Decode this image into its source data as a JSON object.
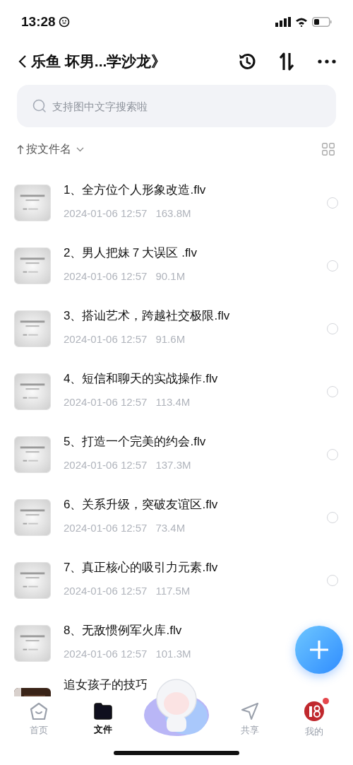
{
  "status_bar": {
    "time": "13:28"
  },
  "header": {
    "title": "乐鱼 坏男...学沙龙》"
  },
  "search": {
    "placeholder": "支持图中文字搜索啦"
  },
  "sort": {
    "label": "按文件名"
  },
  "files": [
    {
      "title": "1、全方位个人形象改造.flv",
      "date": "2024-01-06 12:57",
      "size": "163.8M",
      "selected": false,
      "kind": "light"
    },
    {
      "title": "2、男人把妹７大误区 .flv",
      "date": "2024-01-06 12:57",
      "size": "90.1M",
      "selected": false,
      "kind": "light"
    },
    {
      "title": "3、搭讪艺术，跨越社交极限.flv",
      "date": "2024-01-06 12:57",
      "size": "91.6M",
      "selected": false,
      "kind": "light"
    },
    {
      "title": "4、短信和聊天的实战操作.flv",
      "date": "2024-01-06 12:57",
      "size": "113.4M",
      "selected": false,
      "kind": "light"
    },
    {
      "title": "5、打造一个完美的约会.flv",
      "date": "2024-01-06 12:57",
      "size": "137.3M",
      "selected": false,
      "kind": "light"
    },
    {
      "title": "6、关系升级，突破友谊区.flv",
      "date": "2024-01-06 12:57",
      "size": "73.4M",
      "selected": false,
      "kind": "light"
    },
    {
      "title": "7、真正核心的吸引力元素.flv",
      "date": "2024-01-06 12:57",
      "size": "117.5M",
      "selected": false,
      "kind": "light"
    },
    {
      "title": "8、无敌惯例军火库.flv",
      "date": "2024-01-06 12:57",
      "size": "101.3M",
      "kind": "light"
    },
    {
      "title": "追女孩子的技巧",
      "kind": "dark"
    }
  ],
  "nav": [
    {
      "kind": "home",
      "label": "首页",
      "selected": false
    },
    {
      "kind": "files",
      "label": "文件",
      "selected": true
    },
    {
      "kind": "mascot"
    },
    {
      "kind": "share",
      "label": "共享",
      "selected": false
    },
    {
      "kind": "me",
      "label": "我的",
      "selected": false,
      "badge": true
    }
  ]
}
